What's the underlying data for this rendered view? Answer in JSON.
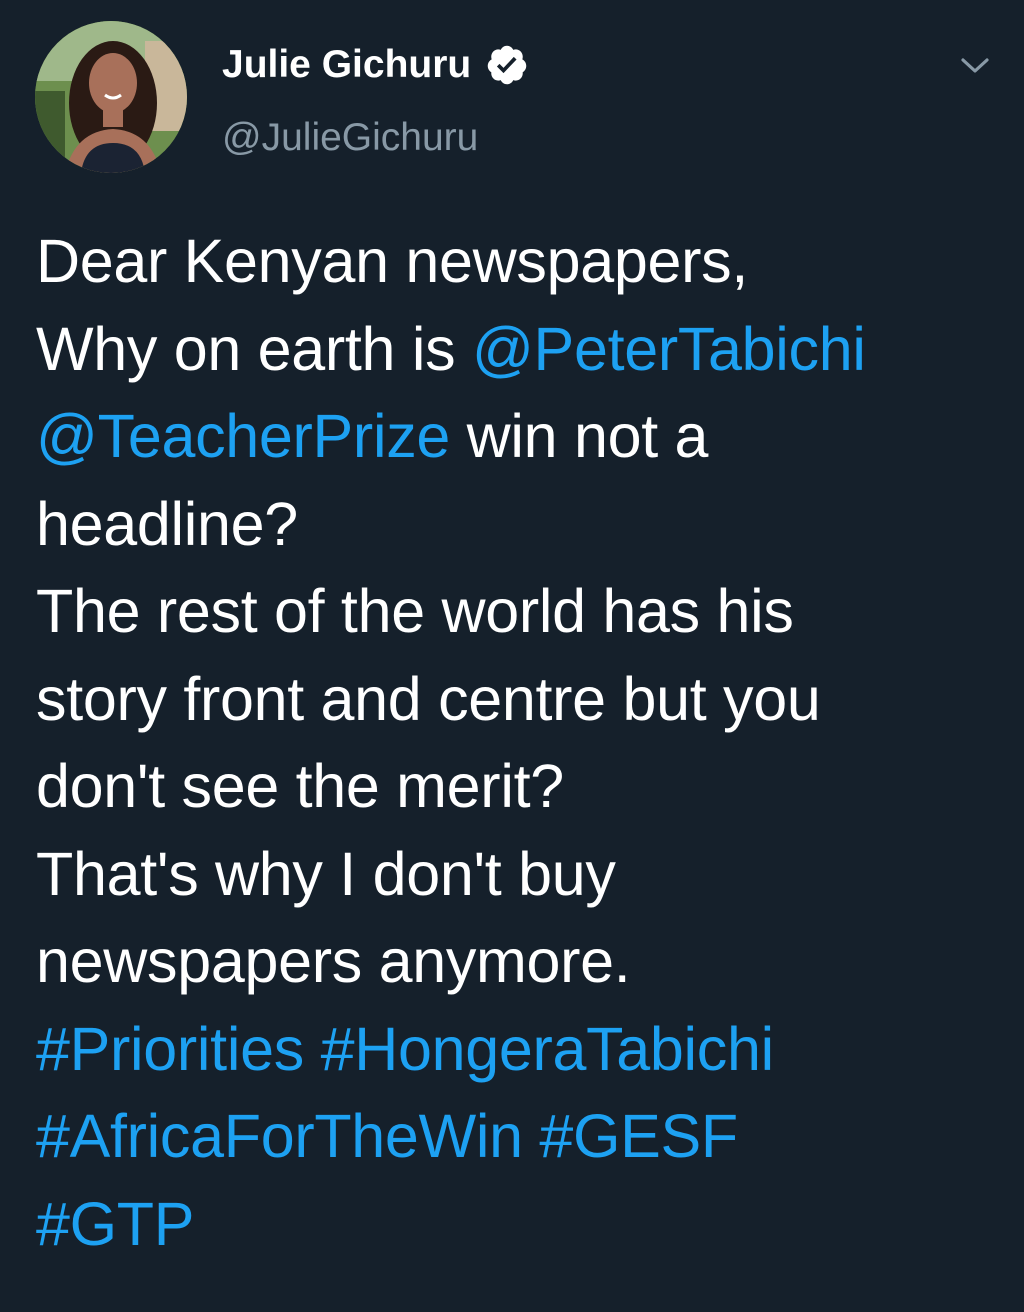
{
  "user": {
    "display_name": "Julie Gichuru",
    "handle": "@JulieGichuru",
    "verified": true
  },
  "tweet": {
    "line1": "Dear Kenyan newspapers,",
    "line2_text": "Why on earth is ",
    "mention_1": "@PeterTabichi",
    "mention_2": "@TeacherPrize",
    "line3_text": " win not a",
    "line4": "headline?",
    "line5": "The rest of the world has his",
    "line6": "story front and centre but you",
    "line7": "don't see the merit?",
    "line8": "That's why I don't buy",
    "line9": "newspapers anymore.",
    "hashtag_1": "#Priorities",
    "hashtag_2": "#HongeraTabichi",
    "hashtag_3": "#AfricaForTheWin",
    "hashtag_4": "#GESF",
    "hashtag_5": "#GTP"
  },
  "icons": {
    "verified": "verified-badge-icon",
    "menu": "chevron-down-icon"
  },
  "colors": {
    "background": "#15202b",
    "text": "#ffffff",
    "secondary_text": "#8899a6",
    "link": "#1da1f2"
  }
}
